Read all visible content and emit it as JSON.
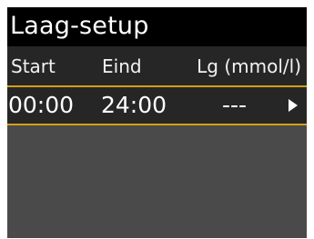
{
  "title": "Laag-setup",
  "columns": {
    "start": "Start",
    "end": "Eind",
    "bg": "Lg (mmol/l)"
  },
  "rows": [
    {
      "start": "00:00",
      "end": "24:00",
      "bg": "---",
      "icon": "chevron-right-icon"
    }
  ],
  "colors": {
    "title_bar": "#000000",
    "screen_bg": "#4a4a4a",
    "row_bg": "#262626",
    "highlight": "#d4a017",
    "text": "#ffffff"
  }
}
